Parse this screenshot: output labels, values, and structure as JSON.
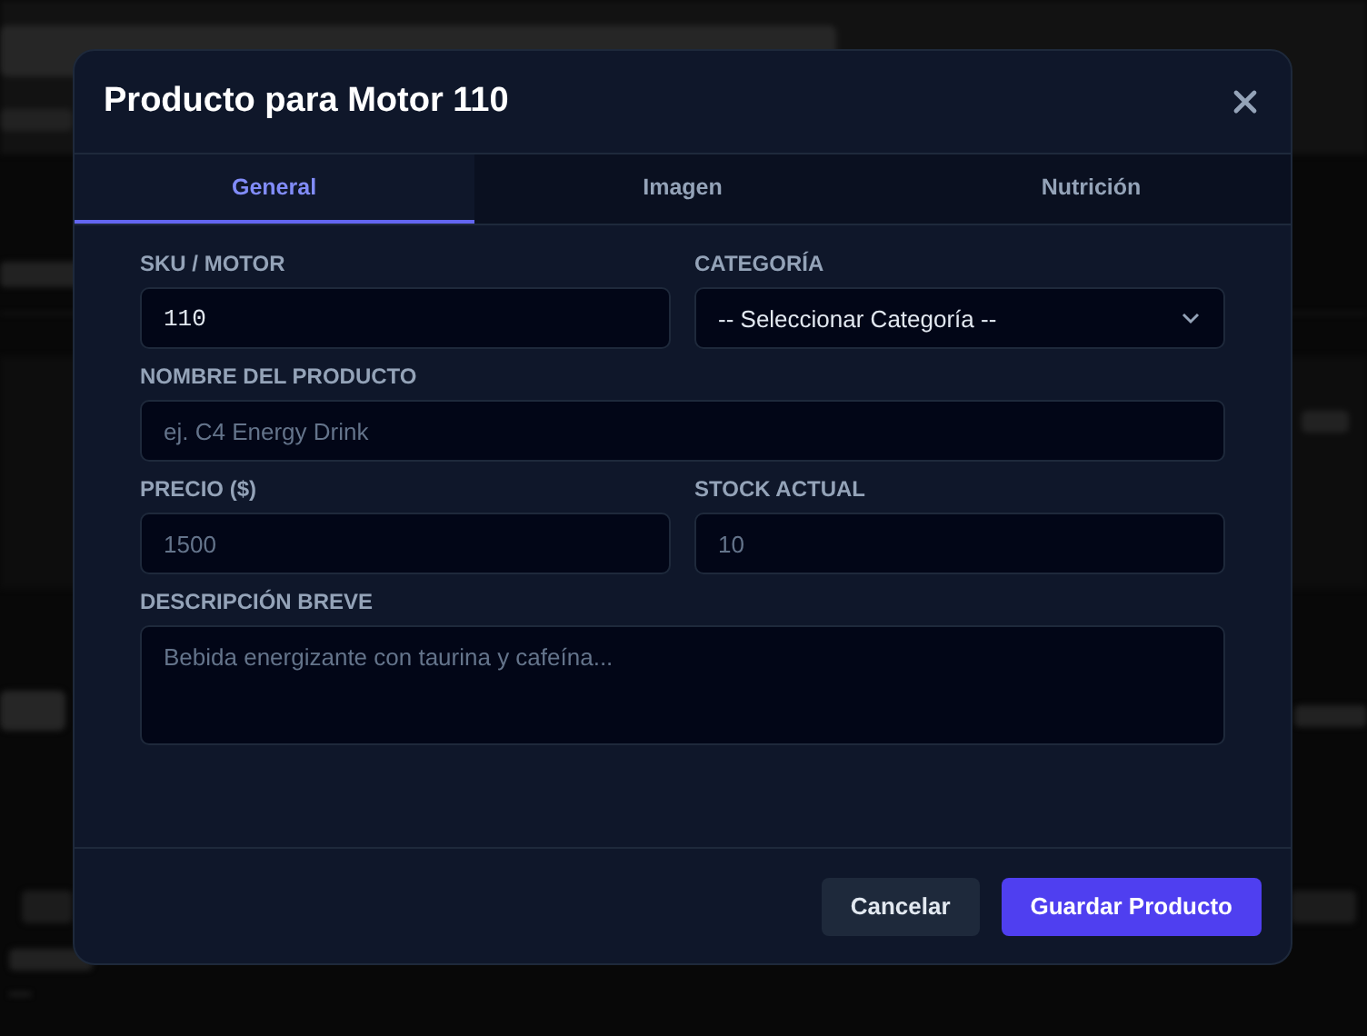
{
  "modal": {
    "title": "Producto para Motor 110",
    "tabs": [
      {
        "label": "General",
        "selected": true
      },
      {
        "label": "Imagen",
        "selected": false
      },
      {
        "label": "Nutrición",
        "selected": false
      }
    ],
    "rows": [
      [
        {
          "label": "SKU / MOTOR",
          "kind": "code",
          "value": "110"
        },
        {
          "label": "CATEGORÍA",
          "kind": "select",
          "value": "-- Seleccionar Categoría --"
        }
      ],
      [
        {
          "label": "NOMBRE DEL PRODUCTO",
          "kind": "text",
          "placeholder": "ej. C4 Energy Drink"
        }
      ],
      [
        {
          "label": "PRECIO ($)",
          "kind": "text",
          "placeholder": "1500"
        },
        {
          "label": "STOCK ACTUAL",
          "kind": "text",
          "placeholder": "10"
        }
      ],
      [
        {
          "label": "DESCRIPCIÓN BREVE",
          "kind": "textarea",
          "placeholder": "Bebida energizante con taurina y cafeína..."
        }
      ]
    ],
    "buttons": [
      {
        "label": "Cancelar",
        "kind": "secondary"
      },
      {
        "label": "Guardar Producto",
        "kind": "primary"
      }
    ]
  }
}
